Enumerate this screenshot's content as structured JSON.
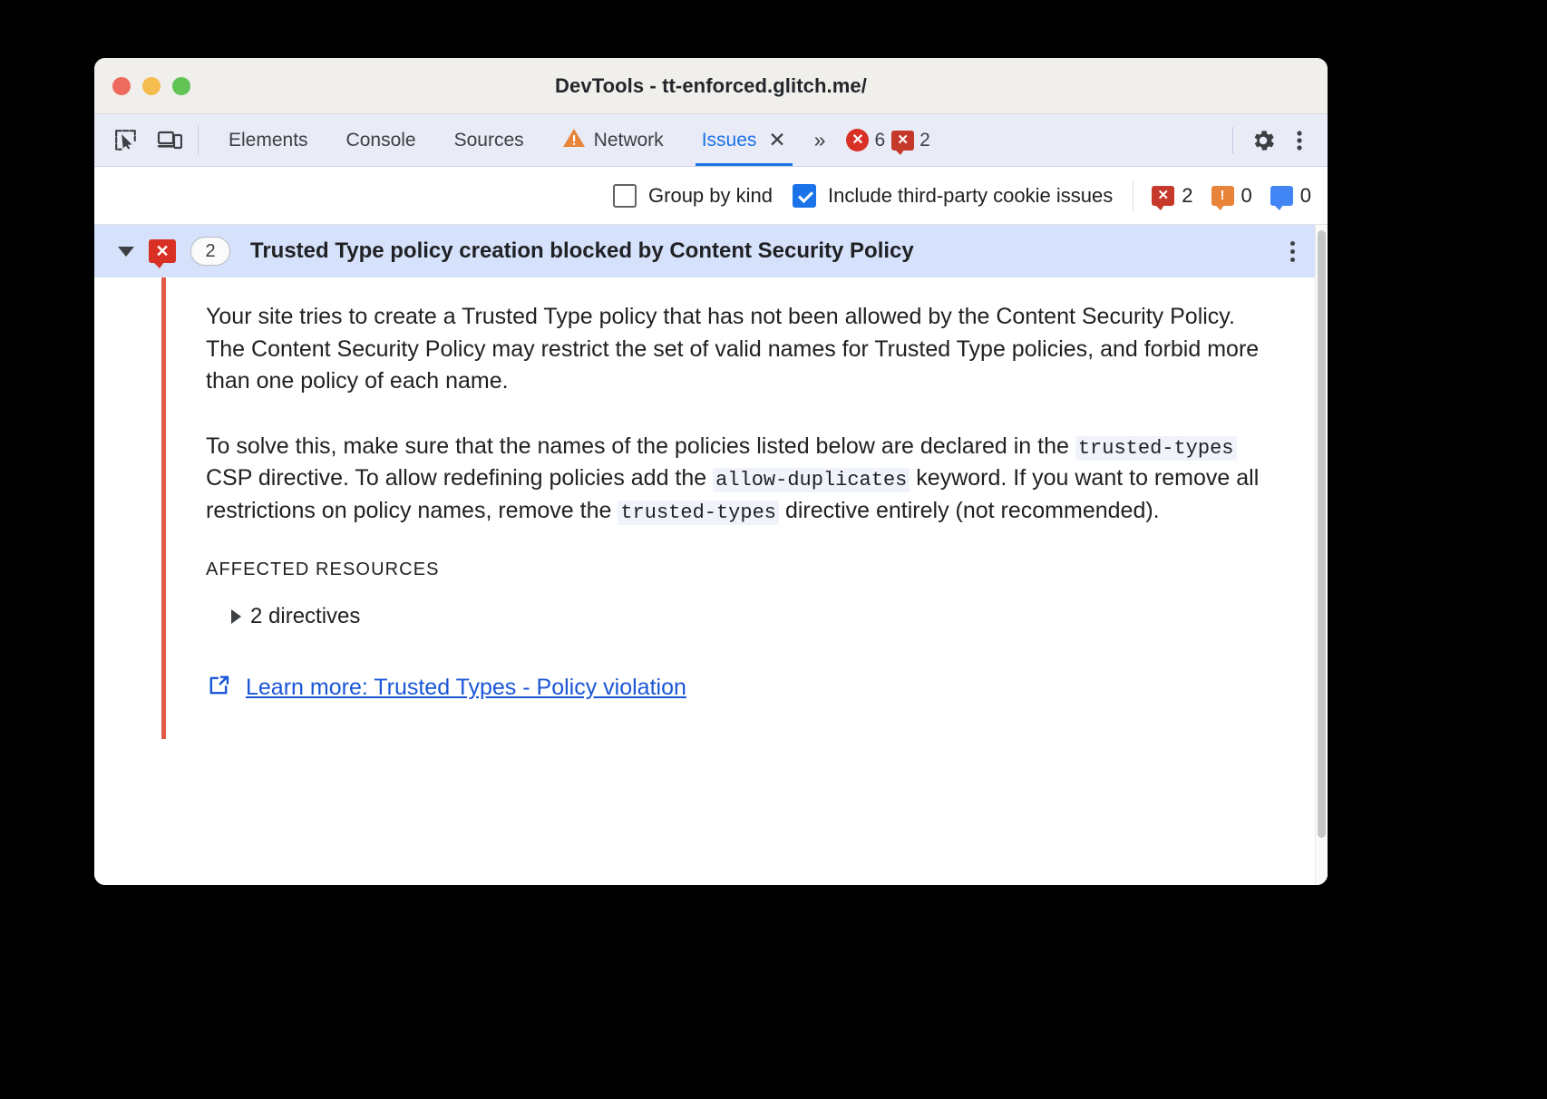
{
  "window": {
    "title": "DevTools - tt-enforced.glitch.me/",
    "traffic_lights": [
      "close",
      "minimize",
      "zoom"
    ]
  },
  "tabbar": {
    "left_icons": [
      {
        "name": "inspect-element-icon"
      },
      {
        "name": "device-toolbar-icon"
      }
    ],
    "tabs": [
      {
        "label": "Elements",
        "active": false,
        "warning": false
      },
      {
        "label": "Console",
        "active": false,
        "warning": false
      },
      {
        "label": "Sources",
        "active": false,
        "warning": false
      },
      {
        "label": "Network",
        "active": false,
        "warning": true
      },
      {
        "label": "Issues",
        "active": true,
        "warning": false,
        "closable": true
      }
    ],
    "overflow_label": "»",
    "tab_close_label": "✕",
    "counters": [
      {
        "icon": "circle-error-icon",
        "symbol": "✕",
        "value": "6",
        "color": "#d93025"
      },
      {
        "icon": "error-bubble-icon",
        "symbol": "✕",
        "value": "2",
        "color": "#c5392b"
      }
    ],
    "settings_icon": "gear-icon",
    "more_icon": "kebab-menu-icon"
  },
  "filterbar": {
    "group_by_kind": {
      "label": "Group by kind",
      "checked": false
    },
    "include_third_party": {
      "label": "Include third-party cookie issues",
      "checked": true
    },
    "counters": [
      {
        "icon": "error-bubble-icon",
        "symbol": "✕",
        "value": "2",
        "color": "#c5392b"
      },
      {
        "icon": "warning-bubble-icon",
        "symbol": "!",
        "value": "0",
        "color": "#e8833a"
      },
      {
        "icon": "info-bubble-icon",
        "symbol": "",
        "value": "0",
        "color": "#4285f4"
      }
    ]
  },
  "issue": {
    "expanded": true,
    "severity_symbol": "✕",
    "count": "2",
    "title": "Trusted Type policy creation blocked by Content Security Policy",
    "kebab": "issue-menu-icon",
    "paragraph1_part1": "Your site tries to create a Trusted Type policy that has not been allowed by the Content Security Policy. The Content Security Policy may restrict the set of valid names for Trusted Type policies, and forbid more than one policy of each name.",
    "paragraph2": {
      "seg1": "To solve this, make sure that the names of the policies listed below are declared in the ",
      "code1": "trusted-types",
      "seg2": " CSP directive. To allow redefining policies add the ",
      "code2": "allow-duplicates",
      "seg3": " keyword. If you want to remove all restrictions on policy names, remove the ",
      "code3": "trusted-types",
      "seg4": " directive entirely (not recommended)."
    },
    "affected_resources_label": "AFFECTED RESOURCES",
    "resource_row": {
      "label": "2 directives",
      "expanded": false
    },
    "learn_more": {
      "icon": "external-link-icon",
      "label": "Learn more: Trusted Types - Policy violation"
    }
  },
  "colors": {
    "accent_blue": "#1a73e8",
    "error_red": "#d93025",
    "warning_orange": "#e8833a",
    "issue_bar_red": "#e25b4a",
    "selected_row": "#d6e2fb",
    "link_blue": "#1a56d6"
  }
}
